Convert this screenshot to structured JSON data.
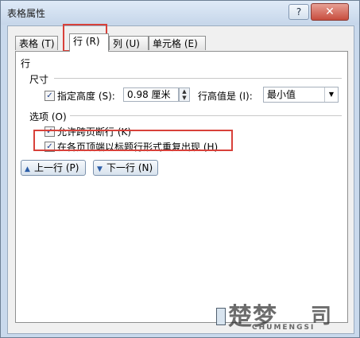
{
  "window": {
    "title": "表格属性",
    "help_label": "?",
    "close_label": "✕"
  },
  "tabs": [
    {
      "label": "表格 (T)"
    },
    {
      "label": "行 (R)"
    },
    {
      "label": "列 (U)"
    },
    {
      "label": "单元格 (E)"
    }
  ],
  "row_tab": {
    "header": "行",
    "size_section": "尺寸",
    "specify_height_label": "指定高度 (S):",
    "specify_height_checked": true,
    "height_value": "0.98 厘米",
    "row_height_is_label": "行高值是 (I):",
    "row_height_mode": "最小值",
    "options_section": "选项 (O)",
    "allow_break_label": "允许跨页断行 (K)",
    "allow_break_checked": true,
    "repeat_header_label": "在各页顶端以标题行形式重复出现 (H)",
    "repeat_header_checked": true,
    "prev_row_label": "上一行 (P)",
    "next_row_label": "下一行 (N)"
  },
  "watermark": {
    "text": "楚梦",
    "sub": "CHUMENGSI",
    "mark": "司"
  },
  "colors": {
    "highlight": "#d8413a",
    "accent": "#2d5ea8"
  }
}
